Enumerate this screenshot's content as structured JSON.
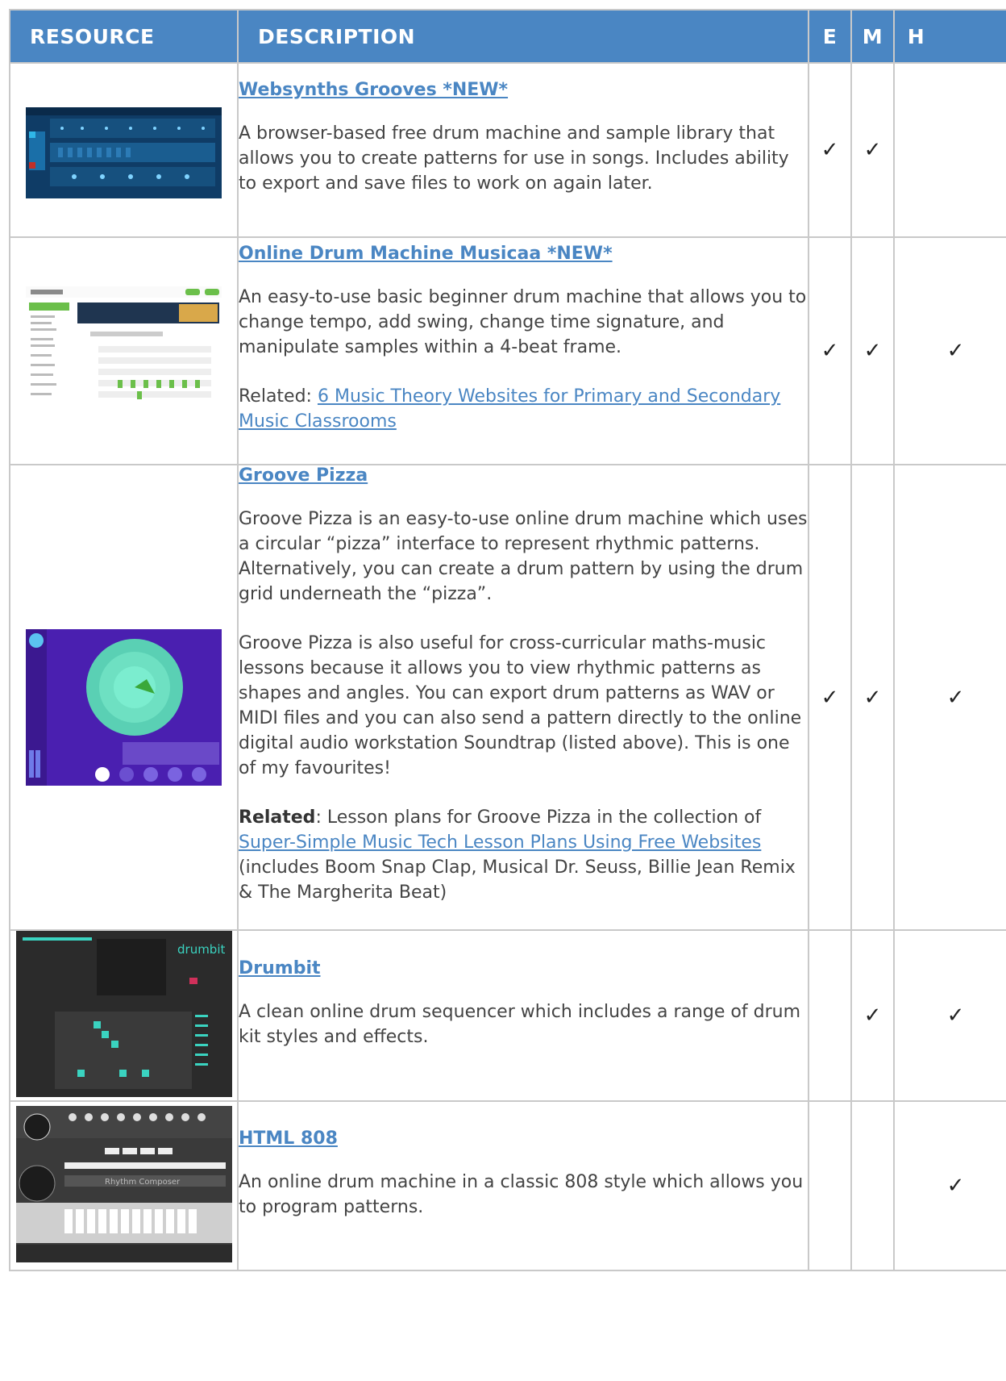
{
  "header": {
    "resource": "RESOURCE",
    "description": "DESCRIPTION",
    "e": "E",
    "m": "M",
    "h": "H"
  },
  "rows": [
    {
      "title": "Websynths Grooves *NEW*",
      "description": "A browser-based free drum machine and sample library that allows you to create patterns for use in songs. Includes ability to export and save files to work on again later.",
      "e": "✓",
      "m": "✓",
      "h": ""
    },
    {
      "title": "Online Drum Machine Musicaa *NEW*",
      "description": "An easy-to-use basic beginner drum machine that allows you to change tempo, add swing, change time signature, and manipulate samples within a 4-beat frame.",
      "related_prefix": "Related: ",
      "related_link": "6 Music Theory Websites for Primary and Secondary Music Classrooms",
      "e": "✓",
      "m": "✓",
      "h": "✓"
    },
    {
      "title": "Groove Pizza",
      "description_1": "Groove Pizza is an easy-to-use online drum machine which uses a circular “pizza” interface to represent rhythmic patterns.  Alternatively, you can create a drum pattern by using the drum grid underneath the “pizza”.",
      "description_2": "Groove Pizza is also useful for cross-curricular maths-music lessons because it allows you to view rhythmic patterns as shapes and angles. You can export drum patterns as WAV or MIDI files and you can also send a pattern directly to the online digital audio workstation Soundtrap (listed above). This is one of my favourites!",
      "related_label": "Related",
      "related_text": ": Lesson plans for Groove Pizza in the collection of ",
      "related_link": "Super-Simple Music Tech Lesson Plans Using Free Websites",
      "related_tail": " (includes Boom Snap Clap, Musical Dr. Seuss, Billie Jean Remix & The Margherita Beat)",
      "e": "✓",
      "m": "✓",
      "h": "✓"
    },
    {
      "title": "Drumbit",
      "description": "A clean online drum sequencer which includes a range of drum kit styles and effects.",
      "thumb_brand": "drumbit",
      "e": "",
      "m": "✓",
      "h": "✓"
    },
    {
      "title": "HTML 808",
      "description": "An online drum machine in a classic 808 style which allows you to program patterns.",
      "thumb_brand": "Rhythm Composer",
      "e": "",
      "m": "",
      "h": "✓"
    }
  ],
  "colors": {
    "header_bg": "#4a86c3",
    "link": "#4a86c3",
    "border": "#c9c9c9"
  }
}
